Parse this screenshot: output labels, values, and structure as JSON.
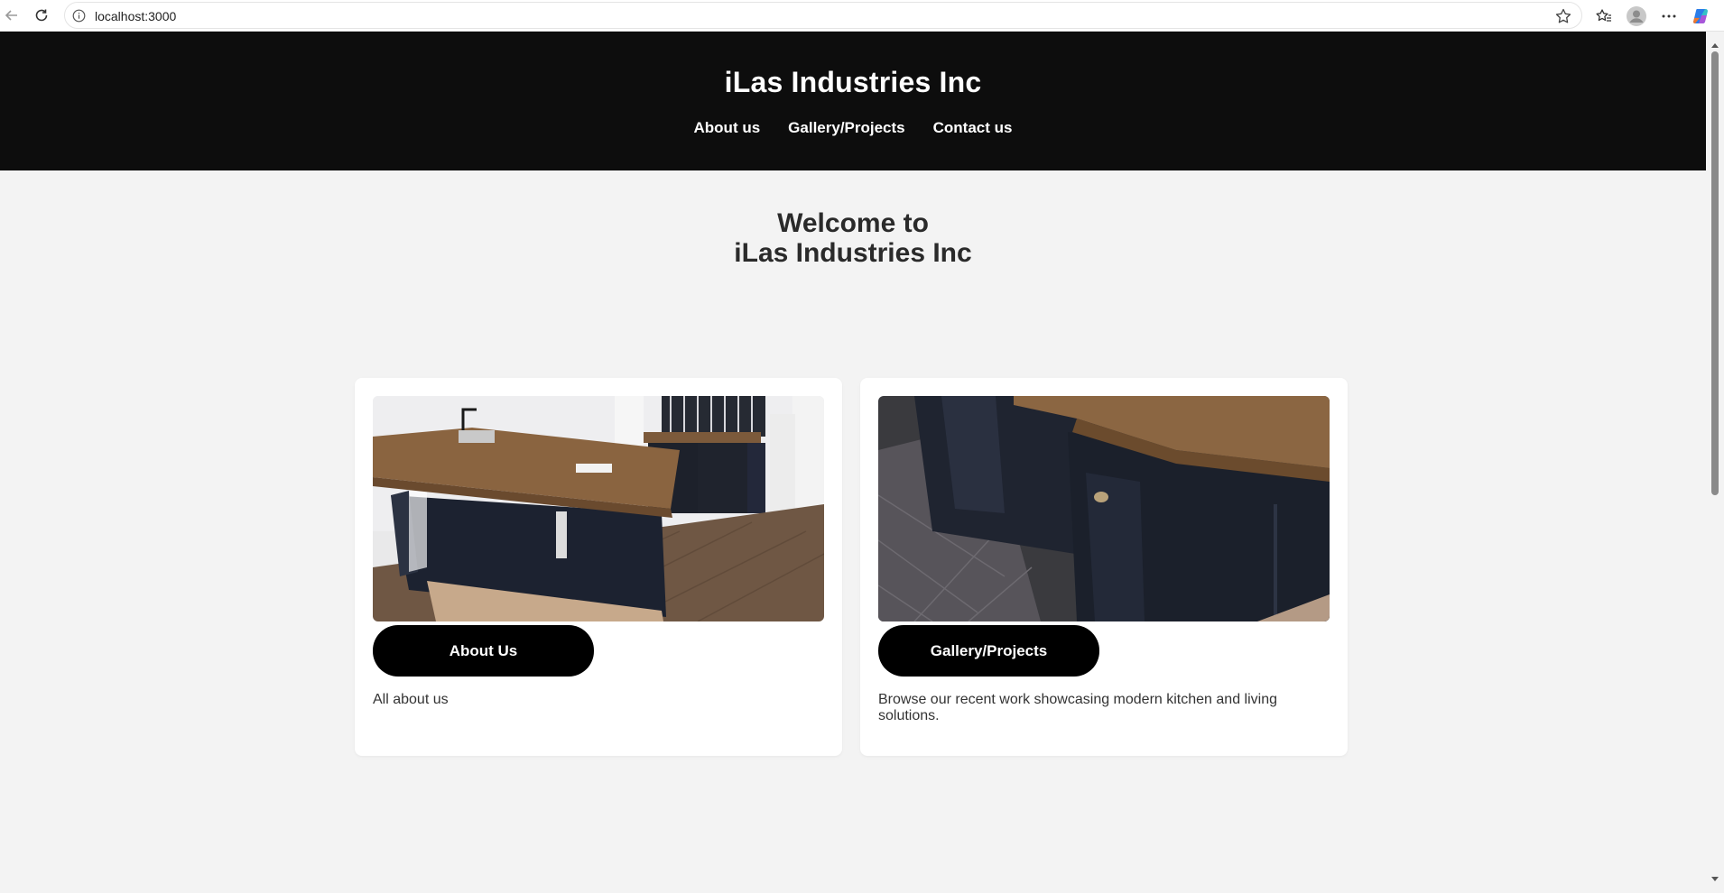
{
  "browser": {
    "url": "localhost:3000"
  },
  "site": {
    "title": "iLas Industries Inc",
    "nav": [
      "About us",
      "Gallery/Projects",
      "Contact us"
    ]
  },
  "hero": {
    "line1": "Welcome to",
    "line2": "iLas Industries Inc"
  },
  "cards": [
    {
      "image": "kitchen-island-photo",
      "button": "About Us",
      "description": "All about us"
    },
    {
      "image": "countertop-corner-photo",
      "button": "Gallery/Projects",
      "description": "Browse our recent work showcasing modern kitchen and living solutions."
    }
  ],
  "colors": {
    "header_bg": "#0d0d0d",
    "page_bg": "#f3f3f3",
    "button_bg": "#000000",
    "cabinet": "#1c2230",
    "wood": "#8a6440"
  }
}
